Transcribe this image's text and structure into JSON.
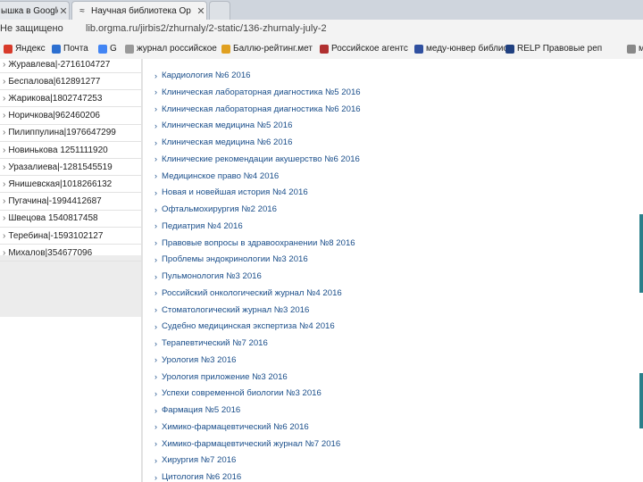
{
  "tabs": [
    {
      "label": "ышка в Google",
      "active": false
    },
    {
      "label": "Научная библиотека Ор",
      "active": true
    },
    {
      "label": "",
      "active": false
    }
  ],
  "address": {
    "security": "Не защищено",
    "url": "lib.orgma.ru/jirbis2/zhurnaly/2-static/136-zhurnaly-july-2"
  },
  "bookmarks": [
    {
      "label": "Яндекс",
      "color": "#d83a2a"
    },
    {
      "label": "Почта",
      "color": "#2c6fd0"
    },
    {
      "label": "G",
      "color": "#4285f4"
    },
    {
      "label": "журнал российское",
      "color": "#999999"
    },
    {
      "label": "Баллю-рейтинг.мет",
      "color": "#e0a020"
    },
    {
      "label": "Российское агентс",
      "color": "#b03030"
    },
    {
      "label": "меду-юнвер библиот",
      "color": "#3050a0"
    },
    {
      "label": "RELP Правовые реп",
      "color": "#204080"
    },
    {
      "label": "ме",
      "color": "#888888"
    }
  ],
  "sidebar": [
    "Журавлева|-2716104727",
    "Беспалова|612891277",
    "Жарикова|1802747253",
    "Норичкова|962460206",
    "Пилиппулина|1976647299",
    "Новинькова 1251111920",
    "Уразалиева|-1281545519",
    "Янишевская|1018266132",
    "Пугачина|-1994412687",
    "Швецова 1540817458",
    "Теребина|-1593102127",
    "Михалов|354677096"
  ],
  "list": [
    "Кардиология №6 2016",
    "Клиническая лабораторная диагностика №5 2016",
    "Клиническая лабораторная диагностика №6 2016",
    "Клиническая медицина №5 2016",
    "Клиническая медицина №6 2016",
    "Клинические рекомендации акушерство №6 2016",
    "Медицинское право №4 2016",
    "Новая и новейшая история №4 2016",
    "Офтальмохирургия №2 2016",
    "Педиатрия №4 2016",
    "Правовые вопросы в здравоохранении №8 2016",
    "Проблемы эндокринологии №3 2016",
    "Пульмонология №3 2016",
    "Российский онкологический журнал №4 2016",
    "Стоматологический журнал №3 2016",
    "Судебно медицинская экспертиза №4 2016",
    "Терапевтический №7 2016",
    "Урология №3 2016",
    "Урология приложение №3 2016",
    "Успехи современной биологии №3 2016",
    "Фармация №5 2016",
    "Химико-фармацевтический №6 2016",
    "Химико-фармацевтический журнал №7 2016",
    "Хирургия №7 2016",
    "Цитология №6 2016"
  ]
}
